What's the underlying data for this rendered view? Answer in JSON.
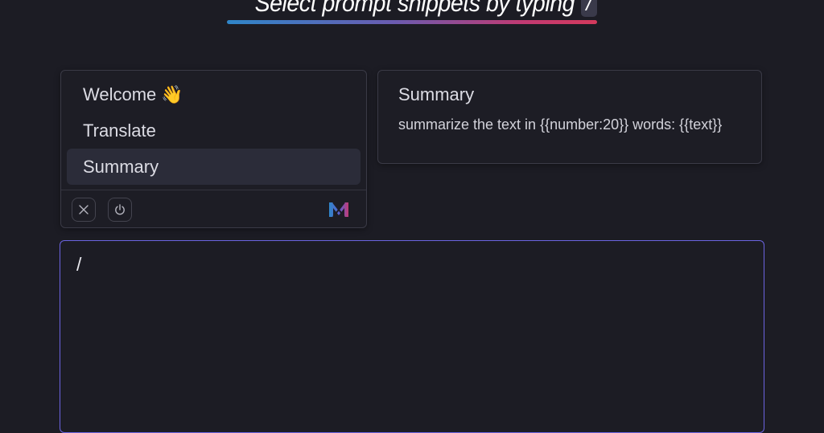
{
  "header": {
    "title": "Select prompt snippets by typing",
    "key_hint": "/",
    "underline_gradient": [
      "#2f86c9",
      "#6a5bb0",
      "#c13a72",
      "#d43a5c"
    ]
  },
  "menu": {
    "items": [
      {
        "label": "Welcome 👋",
        "selected": false
      },
      {
        "label": "Translate",
        "selected": false
      },
      {
        "label": "Summary",
        "selected": true
      }
    ],
    "footer": {
      "close_icon": "close-icon",
      "power_icon": "power-icon",
      "logo": "brand-logo-icon"
    }
  },
  "preview": {
    "title": "Summary",
    "body": "summarize the text in {{number:20}} words: {{text}}"
  },
  "editor": {
    "value": "/",
    "accent_color": "#6b64e0"
  },
  "theme": {
    "background": "#1c1c24",
    "selected_item_bg": "#2b2c39"
  }
}
